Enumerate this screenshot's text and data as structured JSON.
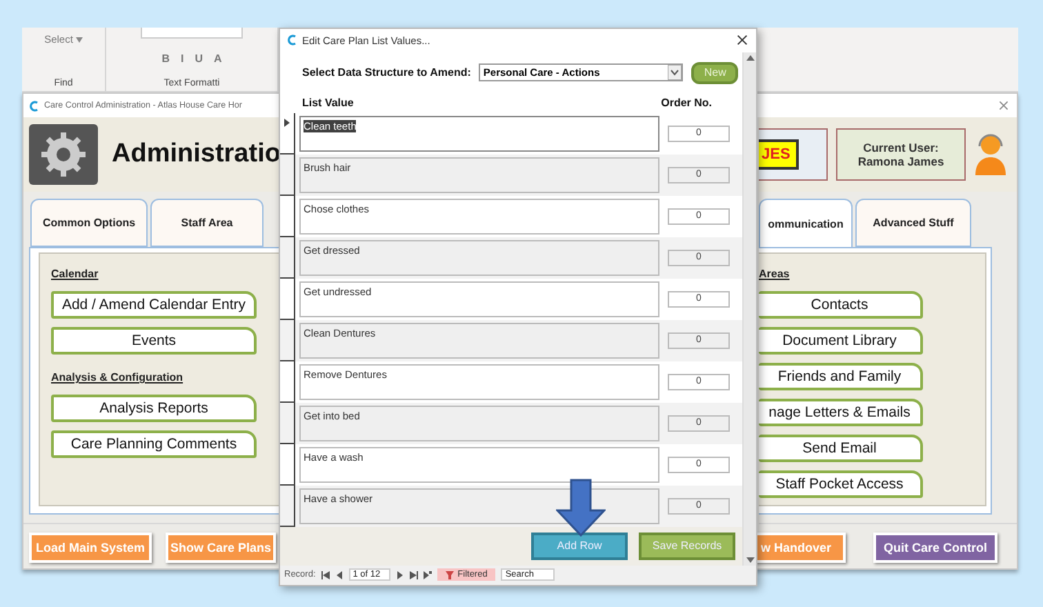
{
  "ribbon": {
    "select_label": "Select",
    "find_label": "Find",
    "format_buttons": [
      "B",
      "I",
      "U",
      "A"
    ],
    "group_label": "Text Formatti"
  },
  "main_window": {
    "title": "Care Control Administration - Atlas House Care Hor",
    "heading": "Administratio",
    "alert": "JES",
    "current_user_label": "Current User:",
    "current_user": "Ramona James"
  },
  "tabs_left": [
    {
      "label": "Common Options",
      "selected": false
    },
    {
      "label": "Staff Area",
      "selected": false
    }
  ],
  "tabs_right": [
    {
      "label": "ommunication",
      "selected": true
    },
    {
      "label": "Advanced Stuff",
      "selected": false
    }
  ],
  "left_sections": [
    {
      "heading": "Calendar",
      "buttons": [
        "Add / Amend Calendar Entry",
        "Events"
      ]
    },
    {
      "heading": "Analysis & Configuration",
      "buttons": [
        "Analysis Reports",
        "Care Planning Comments"
      ]
    }
  ],
  "right_section": {
    "heading": "Areas",
    "buttons": [
      "Contacts",
      "Document Library",
      "Friends and Family",
      "nage Letters & Emails",
      "Send Email",
      "Staff Pocket Access"
    ]
  },
  "bottom_buttons_left": [
    {
      "label": "Load Main System",
      "color": "#f79646"
    },
    {
      "label": "Show Care Plans",
      "color": "#f79646"
    }
  ],
  "bottom_buttons_right": [
    {
      "label": "w Handover",
      "color": "#f79646"
    },
    {
      "label": "Quit Care Control",
      "color": "#8064a2"
    }
  ],
  "dialog": {
    "title": "Edit Care Plan List Values...",
    "select_label": "Select Data Structure to Amend:",
    "select_value": "Personal Care - Actions",
    "new_button": "New",
    "columns": [
      "List Value",
      "Order No."
    ],
    "rows": [
      {
        "value": "Clean teeth",
        "order": "0",
        "selected": true
      },
      {
        "value": "Brush hair",
        "order": "0",
        "selected": false
      },
      {
        "value": "Chose clothes",
        "order": "0",
        "selected": false
      },
      {
        "value": "Get dressed",
        "order": "0",
        "selected": false
      },
      {
        "value": "Get undressed",
        "order": "0",
        "selected": false
      },
      {
        "value": "Clean Dentures",
        "order": "0",
        "selected": false
      },
      {
        "value": "Remove Dentures",
        "order": "0",
        "selected": false
      },
      {
        "value": "Get into bed",
        "order": "0",
        "selected": false
      },
      {
        "value": "Have a wash",
        "order": "0",
        "selected": false
      },
      {
        "value": "Have a shower",
        "order": "0",
        "selected": false
      }
    ],
    "buttons": [
      {
        "label": "Add Row",
        "kind": "teal"
      },
      {
        "label": "Save Records",
        "kind": "green"
      }
    ],
    "navigator": {
      "label": "Record:",
      "position": "1 of 12",
      "filter": "Filtered",
      "search": "Search"
    }
  }
}
